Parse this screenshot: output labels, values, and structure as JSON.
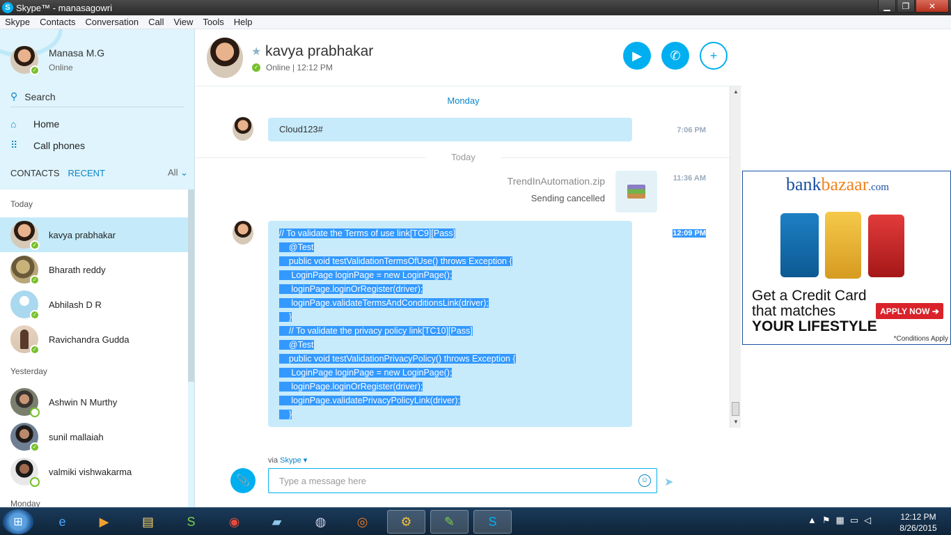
{
  "window": {
    "title": "Skype™ - manasagowri"
  },
  "menu": [
    "Skype",
    "Contacts",
    "Conversation",
    "Call",
    "View",
    "Tools",
    "Help"
  ],
  "me": {
    "name": "Manasa M.G",
    "status": "Online"
  },
  "sidebar": {
    "search_label": "Search",
    "nav": {
      "home": "Home",
      "call_phones": "Call phones"
    },
    "tabs": {
      "contacts": "CONTACTS",
      "recent": "RECENT",
      "filter": "All"
    },
    "groups": [
      {
        "label": "Today",
        "contacts": [
          {
            "name": "kavya prabhakar",
            "presence": "online",
            "selected": true
          },
          {
            "name": "Bharath reddy",
            "presence": "online"
          },
          {
            "name": "Abhilash D R",
            "presence": "online"
          },
          {
            "name": "Ravichandra Gudda",
            "presence": "online"
          }
        ]
      },
      {
        "label": "Yesterday",
        "contacts": [
          {
            "name": "Ashwin N Murthy",
            "presence": "offline"
          },
          {
            "name": "sunil mallaiah",
            "presence": "online"
          },
          {
            "name": "valmiki vishwakarma",
            "presence": "offline"
          }
        ]
      },
      {
        "label": "Monday",
        "contacts": []
      }
    ]
  },
  "conversation": {
    "contact_name": "kavya prabhakar",
    "status": "Online | 12:12 PM",
    "days": {
      "monday": "Monday",
      "today": "Today"
    },
    "messages": {
      "m1": {
        "text": "Cloud123#",
        "time": "7:06 PM"
      },
      "file": {
        "name": "TrendInAutomation.zip",
        "status": "Sending cancelled",
        "time": "11:36 AM"
      },
      "m2": {
        "time": "12:09 PM",
        "lines": [
          "// To validate the Terms of use link[TC9][Pass]",
          "    @Test",
          "    public void testValidationTermsOfUse() throws Exception {",
          "     LoginPage loginPage = new LoginPage();",
          "     loginPage.loginOrRegister(driver);",
          "     loginPage.validateTermsAndConditionsLink(driver);",
          "    }",
          "    // To validate the privacy policy link[TC10][Pass]",
          "    @Test",
          "    public void testValidationPrivacyPolicy() throws Exception {",
          "     LoginPage loginPage = new LoginPage();",
          "     loginPage.loginOrRegister(driver);",
          "     loginPage.validatePrivacyPolicyLink(driver);",
          "    }"
        ]
      }
    },
    "compose": {
      "via_label": "via",
      "via_service": "Skype",
      "placeholder": "Type a message here"
    }
  },
  "ad": {
    "brand_a": "bank",
    "brand_b": "bazaar",
    "brand_c": ".com",
    "headline_1": "Get a Credit Card",
    "headline_2": "that matches",
    "headline_3": "YOUR LIFESTYLE",
    "button": "APPLY NOW",
    "conditions": "*Conditions Apply"
  },
  "taskbar": {
    "time": "12:12 PM",
    "date": "8/26/2015"
  }
}
